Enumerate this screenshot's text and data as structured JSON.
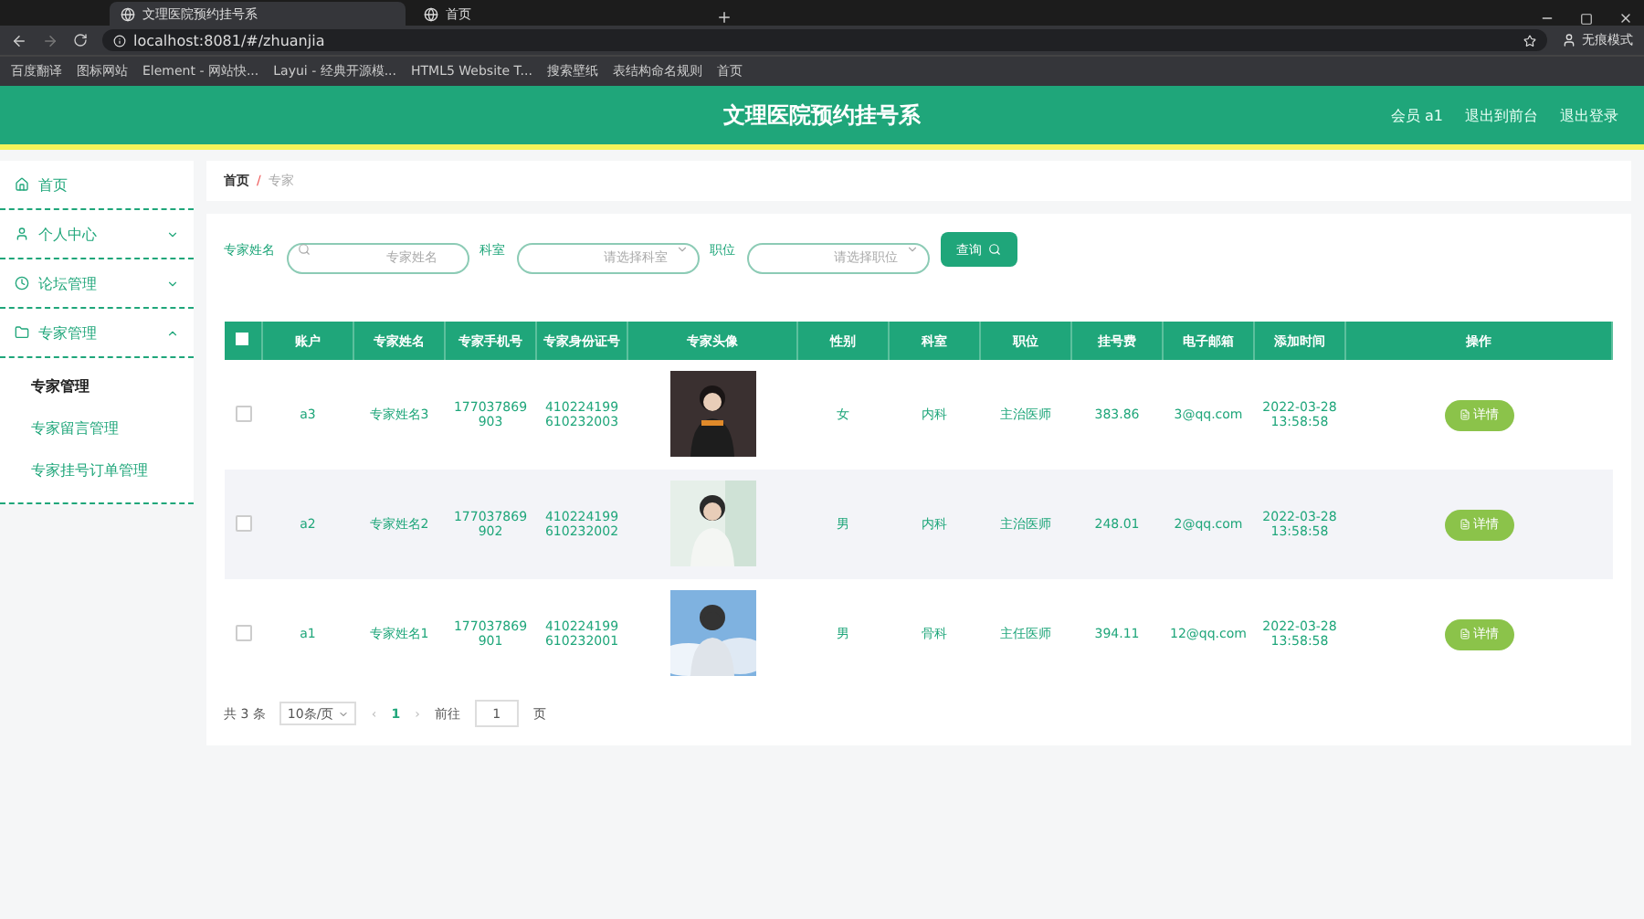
{
  "browser": {
    "tabs": [
      {
        "title": "文理医院预约挂号系",
        "selected": true
      },
      {
        "title": "首页",
        "selected": false
      }
    ],
    "address": "localhost:8081/#/zhuanjia",
    "bookmarks": [
      "百度翻译",
      "图标网站",
      "Element - 网站快...",
      "Layui - 经典开源模...",
      "HTML5 Website T...",
      "搜索壁纸",
      "表结构命名规则",
      "首页"
    ],
    "profile": "无痕模式"
  },
  "header": {
    "title": "文理医院预约挂号系",
    "links": [
      "会员 a1",
      "退出到前台",
      "退出登录"
    ]
  },
  "sidebar": {
    "items": [
      {
        "label": "首页"
      },
      {
        "label": "个人中心",
        "expanded": false
      },
      {
        "label": "论坛管理",
        "expanded": false
      },
      {
        "label": "专家管理",
        "expanded": true,
        "children": [
          {
            "label": "专家管理",
            "selected": true
          },
          {
            "label": "专家留言管理",
            "selected": false
          },
          {
            "label": "专家挂号订单管理",
            "selected": false
          }
        ]
      }
    ]
  },
  "breadcrumb": {
    "items": [
      "首页",
      "专家"
    ],
    "separator": "/"
  },
  "search": {
    "fields": [
      {
        "label": "专家姓名",
        "placeholder": "专家姓名",
        "kind": "text"
      },
      {
        "label": "科室",
        "placeholder": "请选择科室",
        "kind": "select"
      },
      {
        "label": "职位",
        "placeholder": "请选择职位",
        "kind": "select"
      }
    ],
    "button": "查询"
  },
  "table": {
    "all_checked": false,
    "columns": [
      "账户",
      "专家姓名",
      "专家手机号",
      "专家身份证号",
      "专家头像",
      "性别",
      "科室",
      "职位",
      "挂号费",
      "电子邮箱",
      "添加时间",
      "操作"
    ],
    "rows": [
      {
        "cells": [
          "a3",
          "专家姓名3",
          "177037869903",
          "410224199610232003",
          null,
          "女",
          "内科",
          "主治医师",
          "383.86",
          "3@qq.com",
          "2022-03-28 13:58:58"
        ],
        "checked": false,
        "action": "详情",
        "picture": {
          "kind": "picture"
        }
      },
      {
        "cells": [
          "a2",
          "专家姓名2",
          "177037869902",
          "410224199610232002",
          null,
          "男",
          "内科",
          "主治医师",
          "248.01",
          "2@qq.com",
          "2022-03-28 13:58:58"
        ],
        "checked": false,
        "action": "详情",
        "picture": {
          "kind": "picture"
        }
      },
      {
        "cells": [
          "a1",
          "专家姓名1",
          "177037869901",
          "410224199610232001",
          null,
          "男",
          "骨科",
          "主任医师",
          "394.11",
          "12@qq.com",
          "2022-03-28 13:58:58"
        ],
        "checked": false,
        "action": "详情",
        "picture": {
          "kind": "picture"
        }
      }
    ]
  },
  "pagination": {
    "total": "共 3 条",
    "page_size": "10条/页",
    "prev": "‹",
    "pages": [
      {
        "label": "1",
        "selected": true
      }
    ],
    "next": "›",
    "goto": "前往",
    "goto_value": "1",
    "page_unit": "页"
  }
}
